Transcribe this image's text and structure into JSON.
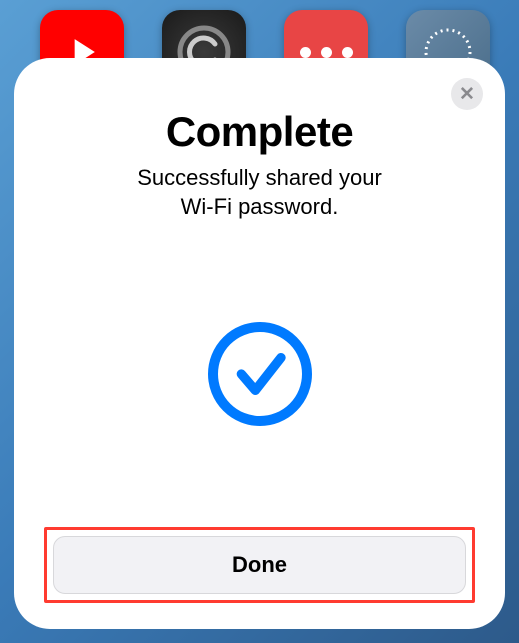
{
  "apps": {
    "youtube": "youtube-app",
    "collection": "collection-app",
    "dots": "dots-app",
    "signal": "signal-app"
  },
  "modal": {
    "title": "Complete",
    "subtitle_line1": "Successfully shared your",
    "subtitle_line2": "Wi-Fi password.",
    "done_label": "Done",
    "close_label": "✕"
  }
}
